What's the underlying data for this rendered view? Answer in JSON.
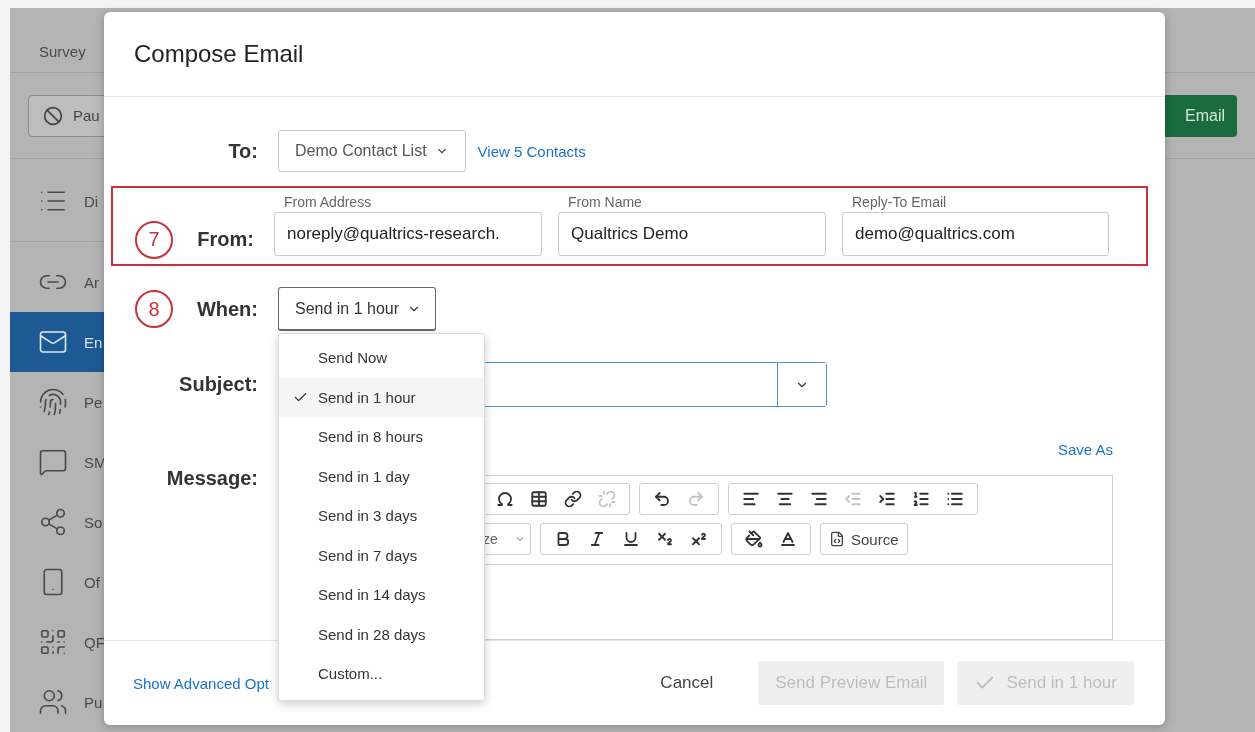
{
  "background": {
    "tabs": [
      {
        "label": "Survey"
      }
    ],
    "pause_button": "Pau",
    "email_button": "Email",
    "sidebar": [
      {
        "kind": "list",
        "label": "Di",
        "selected": false
      },
      {
        "kind": "link",
        "label": "Ar",
        "selected": false
      },
      {
        "kind": "mail",
        "label": "En",
        "selected": true
      },
      {
        "kind": "fingerprint",
        "label": "Pe",
        "selected": false
      },
      {
        "kind": "chat",
        "label": "SM",
        "selected": false
      },
      {
        "kind": "share",
        "label": "So",
        "selected": false
      },
      {
        "kind": "phone",
        "label": "Of",
        "selected": false
      },
      {
        "kind": "qr",
        "label": "QF",
        "selected": false
      },
      {
        "kind": "people",
        "label": "Pu",
        "selected": false
      }
    ]
  },
  "dialog": {
    "title": "Compose Email",
    "to": {
      "label": "To:",
      "list": "Demo Contact List",
      "link": "View 5 Contacts"
    },
    "from": {
      "marker": "7",
      "label": "From:",
      "fields": [
        {
          "caption": "From Address",
          "value": "noreply@qualtrics-research."
        },
        {
          "caption": "From Name",
          "value": "Qualtrics Demo"
        },
        {
          "caption": "Reply-To Email",
          "value": "demo@qualtrics.com"
        }
      ]
    },
    "when": {
      "marker": "8",
      "label": "When:",
      "value": "Send in 1 hour",
      "options": [
        {
          "label": "Send Now",
          "selected": false
        },
        {
          "label": "Send in 1 hour",
          "selected": true
        },
        {
          "label": "Send in 8 hours",
          "selected": false
        },
        {
          "label": "Send in 1 day",
          "selected": false
        },
        {
          "label": "Send in 3 days",
          "selected": false
        },
        {
          "label": "Send in 7 days",
          "selected": false
        },
        {
          "label": "Send in 14 days",
          "selected": false
        },
        {
          "label": "Send in 28 days",
          "selected": false
        },
        {
          "label": "Custom...",
          "selected": false
        }
      ]
    },
    "subject": {
      "label": "Subject:"
    },
    "message": {
      "label": "Message:",
      "save_as": "Save As",
      "font_size": "ze",
      "source": "Source",
      "toolbar_row_1": [
        [
          {
            "kind": "omega",
            "disabled": false
          },
          {
            "kind": "table",
            "disabled": false
          },
          {
            "kind": "link",
            "disabled": false
          },
          {
            "kind": "unlink",
            "disabled": true
          }
        ],
        [
          {
            "kind": "undo",
            "disabled": false
          },
          {
            "kind": "redo",
            "disabled": true
          }
        ],
        [
          {
            "kind": "align-left",
            "disabled": false
          },
          {
            "kind": "align-center",
            "disabled": false
          },
          {
            "kind": "align-right",
            "disabled": false
          },
          {
            "kind": "outdent",
            "disabled": true
          },
          {
            "kind": "indent",
            "disabled": false
          },
          {
            "kind": "numbered-list",
            "disabled": false
          },
          {
            "kind": "bullet-list",
            "disabled": false
          }
        ]
      ],
      "toolbar_row_2": [
        [
          {
            "kind": "bold",
            "disabled": false
          },
          {
            "kind": "italic",
            "disabled": false
          },
          {
            "kind": "underline",
            "disabled": false
          },
          {
            "kind": "subscript",
            "disabled": false
          },
          {
            "kind": "superscript",
            "disabled": false
          }
        ],
        [
          {
            "kind": "background-color",
            "disabled": false
          },
          {
            "kind": "text-color",
            "disabled": false
          }
        ]
      ]
    },
    "footer": {
      "advanced_link": "Show Advanced Opt",
      "cancel": "Cancel",
      "preview_button": {
        "label": "Send Preview Email",
        "disabled": true
      },
      "send_button": {
        "label": "Send in 1 hour",
        "disabled": true
      }
    }
  }
}
